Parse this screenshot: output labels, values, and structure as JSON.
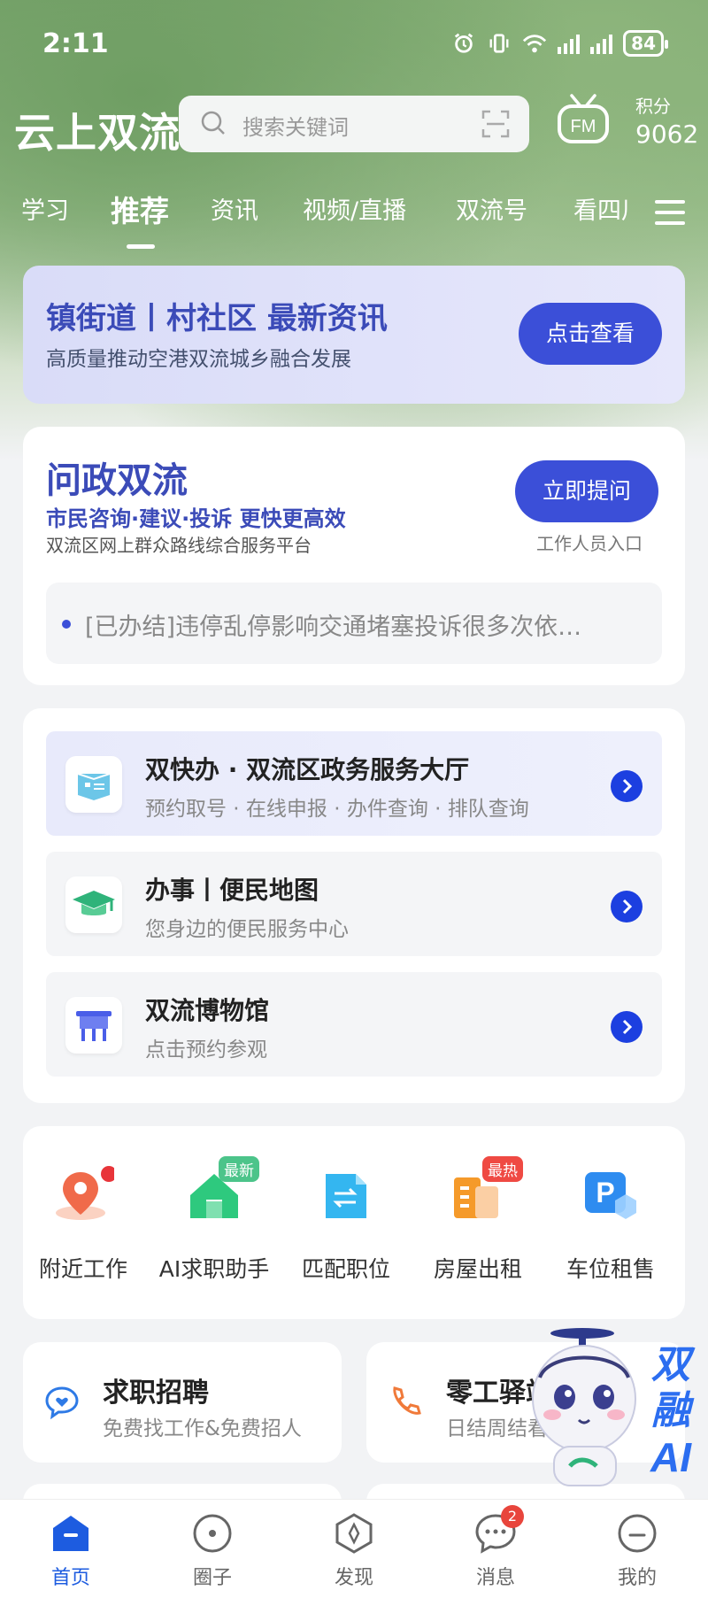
{
  "status_bar": {
    "time": "2:11",
    "battery": "84"
  },
  "header": {
    "logo": "云上双流",
    "search_placeholder": "搜索关键词",
    "fm_label": "FM",
    "points_label": "积分",
    "points_value": "9062"
  },
  "tabs": [
    {
      "label": "学习"
    },
    {
      "label": "推荐",
      "active": true
    },
    {
      "label": "资讯"
    },
    {
      "label": "视频/直播"
    },
    {
      "label": "双流号"
    },
    {
      "label": "看四川"
    }
  ],
  "banner": {
    "title": "镇街道丨村社区 最新资讯",
    "subtitle": "高质量推动空港双流城乡融合发展",
    "button": "点击查看"
  },
  "wenzheng": {
    "title": "问政双流",
    "slogan": "市民咨询·建议·投诉 更快更高效",
    "desc": "双流区网上群众路线综合服务平台",
    "ask_button": "立即提问",
    "staff_entry": "工作人员入口",
    "notice": "[已办结]违停乱停影响交通堵塞投诉很多次依…"
  },
  "services": [
    {
      "title": "双快办 · 双流区政务服务大厅",
      "subtitle": "预约取号 · 在线申报 · 办件查询 · 排队查询",
      "icon": "id-card-icon"
    },
    {
      "title": "办事丨便民地图",
      "subtitle": "您身边的便民服务中心",
      "icon": "graduation-cap-icon"
    },
    {
      "title": "双流博物馆",
      "subtitle": "点击预约参观",
      "icon": "bronze-vessel-icon"
    }
  ],
  "quick": [
    {
      "label": "附近工作",
      "icon": "location-pin-icon",
      "badge": ""
    },
    {
      "label": "AI求职助手",
      "icon": "house-icon",
      "badge": "最新"
    },
    {
      "label": "匹配职位",
      "icon": "match-doc-icon",
      "badge": ""
    },
    {
      "label": "房屋出租",
      "icon": "building-icon",
      "badge": "最热"
    },
    {
      "label": "车位租售",
      "icon": "parking-icon",
      "badge": ""
    }
  ],
  "jobs": [
    {
      "title": "求职招聘",
      "subtitle": "免费找工作&免费招人",
      "icon": "heart-chat-icon"
    },
    {
      "title": "零工驿站",
      "subtitle": "日结周结看",
      "icon": "phone-icon"
    }
  ],
  "mascot": {
    "text_line1": "双",
    "text_line2": "融",
    "text_line3": "AI"
  },
  "nav": [
    {
      "label": "首页",
      "icon": "home-icon",
      "active": true
    },
    {
      "label": "圈子",
      "icon": "circle-icon"
    },
    {
      "label": "发现",
      "icon": "compass-icon"
    },
    {
      "label": "消息",
      "icon": "message-icon",
      "badge": "2"
    },
    {
      "label": "我的",
      "icon": "profile-icon"
    }
  ],
  "colors": {
    "primary": "#3b4fd8",
    "accent_blue": "#1c3fe0",
    "nav_active": "#1d5ce0"
  }
}
